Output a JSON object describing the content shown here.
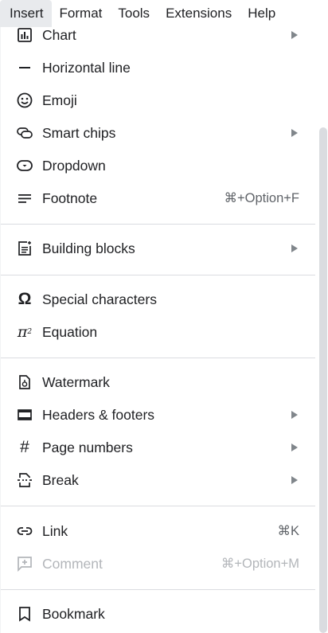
{
  "menubar": {
    "items": [
      "Insert",
      "Format",
      "Tools",
      "Extensions",
      "Help"
    ],
    "active": "Insert"
  },
  "menu": {
    "items": [
      {
        "label": "Chart",
        "icon": "chart-icon",
        "submenu": true
      },
      {
        "label": "Horizontal line",
        "icon": "horizontal-line-icon"
      },
      {
        "label": "Emoji",
        "icon": "emoji-icon"
      },
      {
        "label": "Smart chips",
        "icon": "smart-chips-icon",
        "submenu": true
      },
      {
        "label": "Dropdown",
        "icon": "dropdown-icon"
      },
      {
        "label": "Footnote",
        "icon": "footnote-icon",
        "shortcut": "⌘+Option+F"
      },
      {
        "label": "Building blocks",
        "icon": "building-blocks-icon",
        "submenu": true
      },
      {
        "label": "Special characters",
        "icon": "omega-icon"
      },
      {
        "label": "Equation",
        "icon": "pi-squared-icon"
      },
      {
        "label": "Watermark",
        "icon": "watermark-icon"
      },
      {
        "label": "Headers & footers",
        "icon": "headers-footers-icon",
        "submenu": true
      },
      {
        "label": "Page numbers",
        "icon": "hash-icon",
        "submenu": true
      },
      {
        "label": "Break",
        "icon": "break-icon",
        "submenu": true
      },
      {
        "label": "Link",
        "icon": "link-icon",
        "shortcut": "⌘K"
      },
      {
        "label": "Comment",
        "icon": "comment-add-icon",
        "shortcut": "⌘+Option+M",
        "disabled": true
      },
      {
        "label": "Bookmark",
        "icon": "bookmark-icon"
      }
    ]
  },
  "colors": {
    "text": "#202124",
    "shortcut": "#5f6368",
    "disabled": "#b3b6ba",
    "separator": "#dadce0",
    "active_menu_bg": "#e8eaed"
  }
}
